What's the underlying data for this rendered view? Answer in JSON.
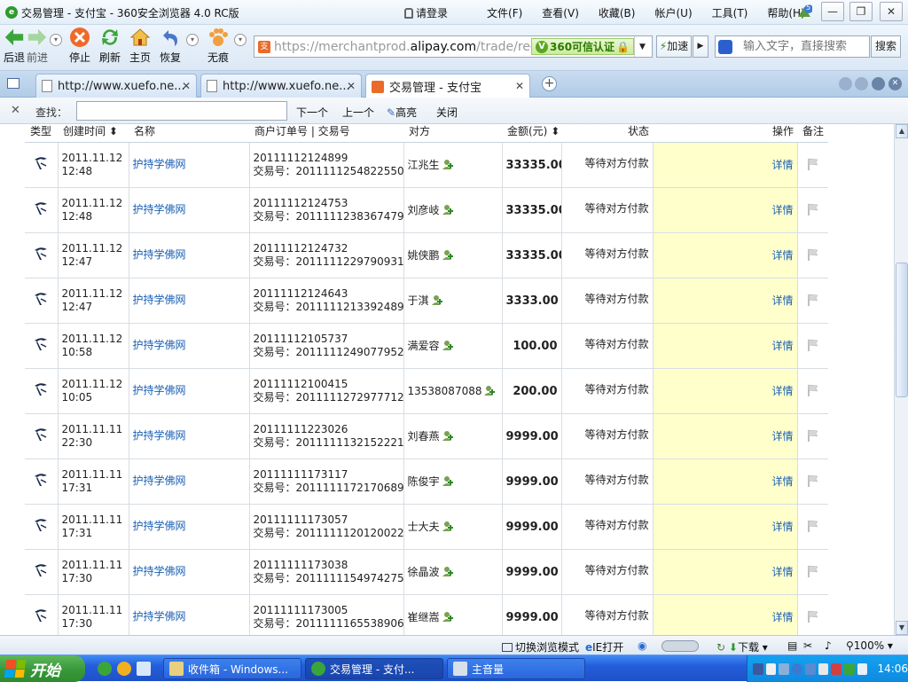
{
  "window": {
    "title": "交易管理 - 支付宝 - 360安全浏览器 4.0 RC版",
    "login": "请登录",
    "menus": [
      "文件(F)",
      "查看(V)",
      "收藏(B)",
      "帐户(U)",
      "工具(T)",
      "帮助(H)"
    ],
    "notify_count": "5"
  },
  "nav": {
    "back": "后退",
    "forward": "前进",
    "stop": "停止",
    "refresh": "刷新",
    "home": "主页",
    "restore": "恢复",
    "incognito": "无痕",
    "url_prefix": "https://merchantprod.",
    "url_host": "alipay.com",
    "url_suffix": "/trade/rec",
    "cert_label": "360可信认证",
    "speed": "加速",
    "search_placeholder": "输入文字，直接搜索",
    "search_button": "搜索"
  },
  "tabs": [
    {
      "label": "http://www.xuefo.ne...",
      "active": false
    },
    {
      "label": "http://www.xuefo.ne...",
      "active": false
    },
    {
      "label": "交易管理 - 支付宝",
      "active": true
    }
  ],
  "find": {
    "label": "查找：",
    "value": "",
    "next": "下一个",
    "prev": "上一个",
    "highlight": "高亮",
    "close": "关闭"
  },
  "table": {
    "headers": {
      "type": "类型",
      "created": "创建时间",
      "name": "名称",
      "order": "商户订单号 | 交易号",
      "counterparty": "对方",
      "amount": "金额(元)",
      "status": "状态",
      "action": "操作",
      "remark": "备注"
    },
    "rows": [
      {
        "date": "2011.11.12",
        "time": "12:48",
        "name": "护持学佛网",
        "order": "20111112124899",
        "trade": "交易号：2011111254822550",
        "cp": "江兆生",
        "amount": "33335.00",
        "status": "等待对方付款",
        "action": "详情"
      },
      {
        "date": "2011.11.12",
        "time": "12:48",
        "name": "护持学佛网",
        "order": "20111112124753",
        "trade": "交易号：2011111238367479",
        "cp": "刘彦岐",
        "amount": "33335.00",
        "status": "等待对方付款",
        "action": "详情"
      },
      {
        "date": "2011.11.12",
        "time": "12:47",
        "name": "护持学佛网",
        "order": "20111112124732",
        "trade": "交易号：2011111229790931",
        "cp": "姚侠鹏",
        "amount": "33335.00",
        "status": "等待对方付款",
        "action": "详情"
      },
      {
        "date": "2011.11.12",
        "time": "12:47",
        "name": "护持学佛网",
        "order": "20111112124643",
        "trade": "交易号：2011111213392489",
        "cp": "于淇",
        "amount": "3333.00",
        "status": "等待对方付款",
        "action": "详情"
      },
      {
        "date": "2011.11.12",
        "time": "10:58",
        "name": "护持学佛网",
        "order": "20111112105737",
        "trade": "交易号：2011111249077952",
        "cp": "满爱容",
        "amount": "100.00",
        "status": "等待对方付款",
        "action": "详情"
      },
      {
        "date": "2011.11.12",
        "time": "10:05",
        "name": "护持学佛网",
        "order": "20111112100415",
        "trade": "交易号：2011111272977712",
        "cp": "13538087088",
        "amount": "200.00",
        "status": "等待对方付款",
        "action": "详情"
      },
      {
        "date": "2011.11.11",
        "time": "22:30",
        "name": "护持学佛网",
        "order": "20111111223026",
        "trade": "交易号：2011111132152221",
        "cp": "刘春燕",
        "amount": "9999.00",
        "status": "等待对方付款",
        "action": "详情"
      },
      {
        "date": "2011.11.11",
        "time": "17:31",
        "name": "护持学佛网",
        "order": "20111111173117",
        "trade": "交易号：2011111172170689",
        "cp": "陈俊宇",
        "amount": "9999.00",
        "status": "等待对方付款",
        "action": "详情"
      },
      {
        "date": "2011.11.11",
        "time": "17:31",
        "name": "护持学佛网",
        "order": "20111111173057",
        "trade": "交易号：2011111120120022",
        "cp": "士大夫",
        "amount": "9999.00",
        "status": "等待对方付款",
        "action": "详情"
      },
      {
        "date": "2011.11.11",
        "time": "17:30",
        "name": "护持学佛网",
        "order": "20111111173038",
        "trade": "交易号：2011111154974275",
        "cp": "徐晶波",
        "amount": "9999.00",
        "status": "等待对方付款",
        "action": "详情"
      },
      {
        "date": "2011.11.11",
        "time": "17:30",
        "name": "护持学佛网",
        "order": "20111111173005",
        "trade": "交易号：2011111165538906",
        "cp": "崔继嵩",
        "amount": "9999.00",
        "status": "等待对方付款",
        "action": "详情"
      }
    ]
  },
  "statusbar": {
    "switch_mode": "切换浏览模式",
    "ie_open": "IE打开",
    "download": "下载",
    "zoom": "100%"
  },
  "taskbar": {
    "start": "开始",
    "tasks": [
      {
        "label": "收件箱 - Windows...",
        "active": false
      },
      {
        "label": "交易管理 - 支付...",
        "active": true
      },
      {
        "label": "主音量",
        "active": false
      }
    ],
    "clock": "14:06"
  }
}
